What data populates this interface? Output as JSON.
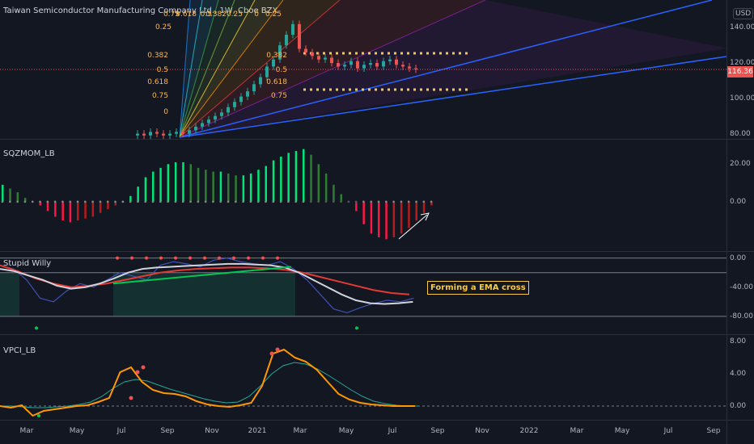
{
  "header": {
    "title": "Taiwan Semiconductor Manufacturing Company Ltd., 1W, Cboe BZX",
    "currency": "USD",
    "last_price": "116.36"
  },
  "panes": {
    "momentum": {
      "title": "SQZMOM_LB"
    },
    "willy": {
      "title": "Stupid Willy",
      "note": "Forming a EMA cross"
    },
    "vpci": {
      "title": "VPCI_LB"
    }
  },
  "colors": {
    "bg": "#131722",
    "up": "#26a69a",
    "down": "#ef5350",
    "grid": "#2a2e39",
    "mom_up_strong": "#00e676",
    "mom_up_weak": "#2e7d32",
    "mom_down_strong": "#ff1744",
    "mom_down_weak": "#b71c1c",
    "fib_lines": "#f7c948"
  },
  "chart_data": [
    {
      "type": "candlestick",
      "title": "Taiwan Semiconductor Manufacturing Company Ltd., 1W, Cboe BZX",
      "y_ticks": [
        "140.00",
        "120.00",
        "100.00",
        "80.00"
      ],
      "ylim": [
        78,
        152
      ],
      "fib_labels": [
        "0.75",
        "0.618",
        "0.5",
        "0.382",
        "0.25",
        "0",
        "0.25",
        "0.382",
        "0.5",
        "0.618",
        "0.75",
        "0",
        "0.25",
        "0.382",
        "0.5",
        "0.618",
        "0.75"
      ],
      "close_approx": [
        80,
        79,
        81,
        80,
        79,
        80,
        81,
        80,
        82,
        84,
        86,
        88,
        90,
        92,
        95,
        98,
        101,
        104,
        108,
        112,
        118,
        122,
        130,
        136,
        142,
        128,
        126,
        124,
        122,
        123,
        120,
        118,
        119,
        121,
        117,
        119,
        120,
        118,
        121,
        122,
        119,
        118,
        117,
        116.36
      ],
      "last_value": "116.36"
    },
    {
      "type": "bar",
      "title": "SQZMOM_LB",
      "y_ticks": [
        "20.00",
        "0.00"
      ],
      "ylim": [
        -25,
        30
      ],
      "values_approx": [
        9,
        7,
        5,
        2,
        0,
        -2,
        -5,
        -8,
        -10,
        -11,
        -10,
        -9,
        -8,
        -6,
        -4,
        -2,
        0,
        3,
        8,
        13,
        16,
        18,
        20,
        21,
        21,
        20,
        18,
        17,
        16,
        16,
        15,
        14,
        14,
        15,
        17,
        19,
        22,
        24,
        26,
        27,
        28,
        25,
        20,
        15,
        9,
        4,
        0,
        -5,
        -12,
        -17,
        -19,
        -20,
        -19,
        -17,
        -14,
        -10,
        -6,
        -2
      ]
    },
    {
      "type": "line",
      "title": "Stupid Willy",
      "y_ticks": [
        "0.00",
        "-40.00",
        "-80.00"
      ],
      "ylim": [
        -100,
        4
      ],
      "series_approx": {
        "fast": [
          -10,
          -15,
          -30,
          -55,
          -60,
          -45,
          -35,
          -40,
          -30,
          -20,
          -25,
          -30,
          -10,
          -5,
          -8,
          -12,
          -3,
          0,
          -5,
          -8,
          -10,
          -5,
          -15,
          -30,
          -50,
          -70,
          -75,
          -68,
          -62,
          -58,
          -60,
          -55
        ],
        "slow": [
          -15,
          -18,
          -24,
          -30,
          -38,
          -42,
          -40,
          -35,
          -28,
          -20,
          -15,
          -13,
          -12,
          -11,
          -10,
          -9,
          -8,
          -8,
          -9,
          -10,
          -13,
          -20,
          -30,
          -40,
          -50,
          -58,
          -62,
          -63,
          -62,
          -60
        ],
        "ema_long": [
          -10,
          -18,
          -28,
          -35,
          -40,
          -38,
          -35,
          -30,
          -25,
          -20,
          -17,
          -15,
          -14,
          -13,
          -13,
          -14,
          -16,
          -20,
          -26,
          -32,
          -38,
          -44,
          -48,
          -50
        ]
      }
    },
    {
      "type": "line",
      "title": "VPCI_LB",
      "y_ticks": [
        "8.00",
        "4.00",
        "0.00"
      ],
      "ylim": [
        -1.5,
        8.5
      ],
      "series_approx": {
        "vpci": [
          0,
          -0.2,
          0.1,
          -1.2,
          -0.6,
          -0.4,
          -0.2,
          0,
          0.1,
          0.5,
          1.0,
          4.2,
          4.8,
          3.0,
          2.0,
          1.6,
          1.5,
          1.2,
          0.6,
          0.2,
          0.0,
          -0.1,
          0.1,
          0.4,
          2.5,
          6.5,
          7.0,
          6.0,
          5.5,
          4.5,
          3.0,
          1.5,
          0.8,
          0.4,
          0.2,
          0.1,
          0.0,
          0.0,
          0.0
        ],
        "signal": [
          0,
          0,
          -0.1,
          -0.2,
          -0.2,
          -0.1,
          0,
          0.2,
          0.5,
          1.2,
          2.2,
          3.0,
          3.3,
          3.1,
          2.6,
          2.1,
          1.7,
          1.3,
          0.9,
          0.6,
          0.4,
          0.5,
          1.2,
          2.5,
          4.0,
          5.0,
          5.4,
          5.2,
          4.6,
          3.8,
          2.9,
          2.0,
          1.2,
          0.6,
          0.3,
          0.1,
          0.0,
          0.0
        ]
      }
    }
  ],
  "x_axis_labels": [
    "Mar",
    "May",
    "Jul",
    "Sep",
    "Nov",
    "2021",
    "Mar",
    "May",
    "Jul",
    "Sep",
    "Nov",
    "2022",
    "Mar",
    "May",
    "Jul",
    "Sep"
  ]
}
